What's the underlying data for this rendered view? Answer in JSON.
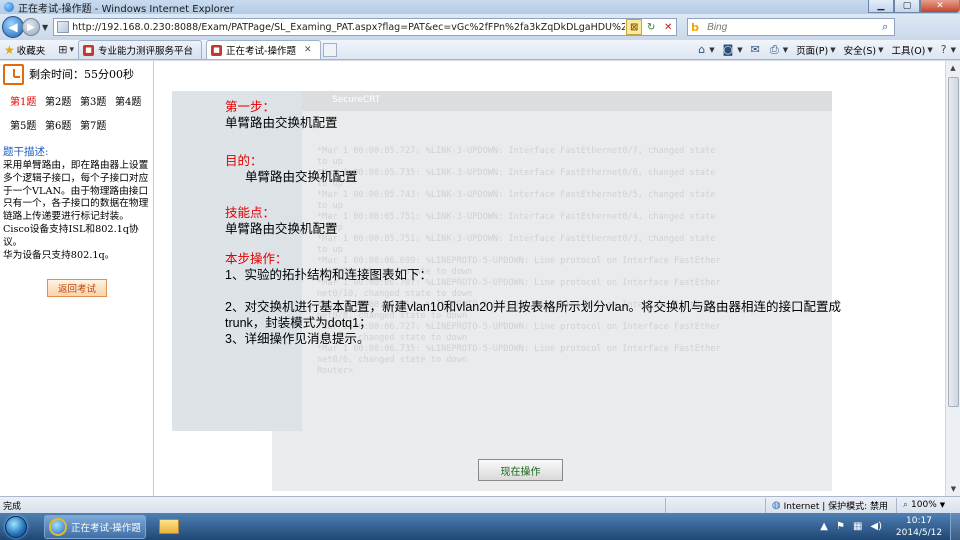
{
  "window": {
    "title": "正在考试-操作题 - Windows Internet Explorer"
  },
  "address": {
    "url": "http://192.168.0.230:8088/Exam/PATPage/SL_Examing_PAT.aspx?flag=PAT&ec=vGc%2fFPn%2fa3kZqDkDLgaHDU%2bSzSTju1j%2fF38%2fG63Z0G",
    "search_placeholder": "Bing"
  },
  "favorites": {
    "label": "收藏夹",
    "tabs": [
      {
        "label": "专业能力测评服务平台",
        "active": false
      },
      {
        "label": "正在考试-操作题",
        "active": true
      }
    ],
    "commands": {
      "page": "页面(P)",
      "safety": "安全(S)",
      "tools": "工具(O)"
    }
  },
  "sidebar": {
    "timer_label": "剩余时间：55分00秒",
    "questions": [
      "第1题",
      "第2题",
      "第3题",
      "第4题",
      "第5题",
      "第6题",
      "第7题"
    ],
    "current_question": 0,
    "desc_heading": "题干描述:",
    "desc_lines": [
      "采用单臂路由，即在路由器上设置",
      "多个逻辑子接口，每个子接口对应",
      "于一个VLAN。由于物理路由接口",
      "只有一个，各子接口的数据在物理",
      "链路上传递要进行标记封装。",
      "Cisco设备支持ISL和802.1q协议。",
      "华为设备只支持802.1q。"
    ],
    "back_button": "返回考试"
  },
  "task": {
    "step_heading": "第一步：",
    "step_text": "单臂路由交换机配置",
    "goal_heading": "目的：",
    "goal_text": "单臂路由交换机配置",
    "skill_heading": "技能点：",
    "skill_text": "单臂路由交换机配置",
    "ops_heading": "本步操作：",
    "ops_lines": [
      "1、实验的拓扑结构和连接图表如下：",
      "",
      "2、对交换机进行基本配置，新建vlan10和vlan20并且按表格所示划分vlan。将交换机与路由器相连的接口配置成",
      "trunk，封装模式为dotq1；",
      "3、详细操作见消息提示。"
    ],
    "run_button": "现在操作"
  },
  "ghost_terminal": {
    "title": "SecureCRT",
    "lines": [
      "*Mar  1 00:00:05.727: %LINK-3-UPDOWN: Interface FastEthernet0/7, changed state",
      "to up",
      "*Mar  1 00:00:05.735: %LINK-3-UPDOWN: Interface FastEthernet0/6, changed state",
      "to up",
      "*Mar  1 00:00:05.743: %LINK-3-UPDOWN: Interface FastEthernet0/5, changed state",
      "to up",
      "*Mar  1 00:00:05.751: %LINK-3-UPDOWN: Interface FastEthernet0/4, changed state",
      "to up",
      "*Mar  1 00:00:05.751: %LINK-3-UPDOWN: Interface FastEthernet0/3, changed state",
      "to up",
      "*Mar  1 00:00:06.699: %LINEPROTO-5-UPDOWN: Line protocol on Interface FastEther",
      "net0/12, changed state to down",
      "*Mar  1 00:00:06.707: %LINEPROTO-5-UPDOWN: Line protocol on Interface FastEther",
      "net0/10, changed state to down",
      "*Mar  1 00:00:06.711: %LINEPROTO-5-UPDOWN: Line protocol on Interface FastEther",
      "net0/8, changed state to down",
      "*Mar  1 00:00:06.727: %LINEPROTO-5-UPDOWN: Line protocol on Interface FastEther",
      "net0/7, changed state to down",
      "*Mar  1 00:00:06.735: %LINEPROTO-5-UPDOWN: Line protocol on Interface FastEther",
      "net0/6, changed state to down",
      "Router>"
    ]
  },
  "status": {
    "text": "完成",
    "zone": "Internet | 保护模式: 禁用",
    "zoom": "100%"
  },
  "taskbar": {
    "ie_item": "正在考试-操作题 ...",
    "time": "10:17",
    "date": "2014/5/12"
  }
}
